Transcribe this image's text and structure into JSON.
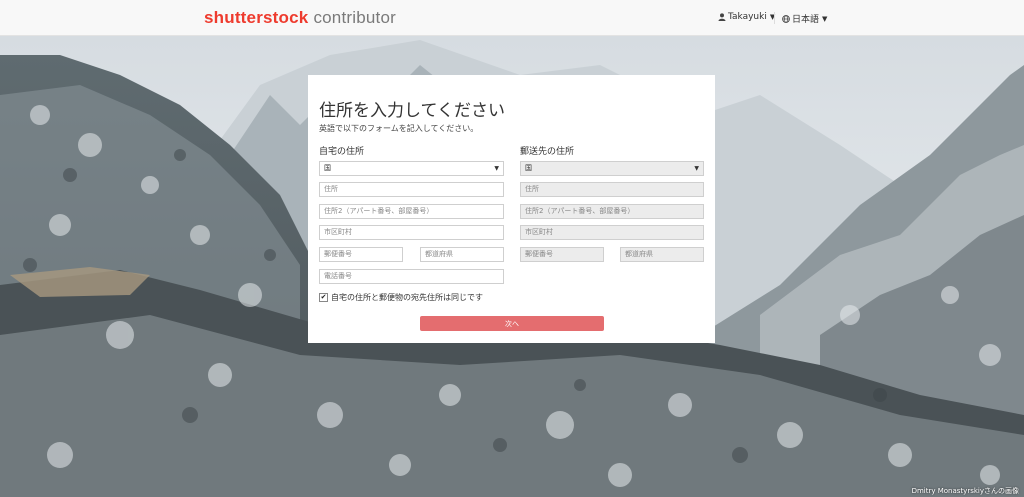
{
  "header": {
    "logo_brand": "shutterstock",
    "logo_sub": "contributor",
    "user_name": "Takayuki",
    "language": "日本語"
  },
  "form": {
    "title": "住所を入力してください",
    "subtitle": "英語で以下のフォームを記入してください。",
    "home": {
      "heading": "自宅の住所",
      "country_value": "国",
      "address_placeholder": "住所",
      "address2_placeholder": "住所2（アパート番号、部屋番号）",
      "city_placeholder": "市区町村",
      "zip_placeholder": "郵便番号",
      "state_placeholder": "都道府県",
      "phone_placeholder": "電話番号"
    },
    "mailing": {
      "heading": "郵送先の住所",
      "country_value": "国",
      "address_placeholder": "住所",
      "address2_placeholder": "住所2（アパート番号、部屋番号）",
      "city_placeholder": "市区町村",
      "zip_placeholder": "郵便番号",
      "state_placeholder": "都道府県"
    },
    "same_address_label": "自宅の住所と郵便物の宛先住所は同じです",
    "same_address_checked": true,
    "next_button": "次へ",
    "accent_color": "#e46d6f"
  },
  "footer": {
    "photo_credit": "Dmitry Monastyrskiyさんの画像"
  },
  "icons": {
    "user": "user-icon",
    "globe": "globe-icon",
    "chevron": "chevron-down-icon",
    "caret": "caret-down-icon",
    "check": "check-icon"
  }
}
